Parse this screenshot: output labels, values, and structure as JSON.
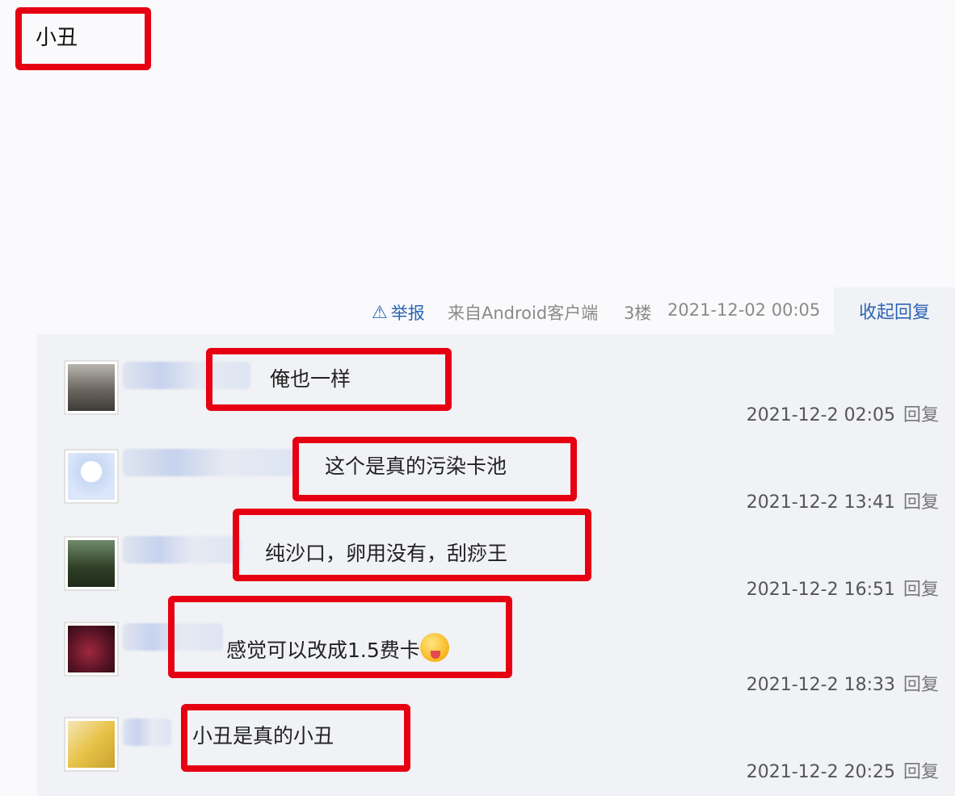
{
  "post": {
    "text": "小丑"
  },
  "post_meta": {
    "report_icon": "warning-triangle-icon",
    "report_label": "举报",
    "client": "来自Android客户端",
    "floor": "3楼",
    "time": "2021-12-02 00:05",
    "collapse_label": "收起回复"
  },
  "replies": [
    {
      "text": "俺也一样",
      "time": "2021-12-2 02:05",
      "reply_label": "回复"
    },
    {
      "text": "这个是真的污染卡池",
      "time": "2021-12-2 13:41",
      "reply_label": "回复"
    },
    {
      "text": "纯沙口，卵用没有，刮痧王",
      "time": "2021-12-2 16:51",
      "reply_label": "回复"
    },
    {
      "text": "感觉可以改成1.5费卡",
      "emoji": "tongue-out-emoji",
      "time": "2021-12-2 18:33",
      "reply_label": "回复"
    },
    {
      "text": "小丑是真的小丑",
      "time": "2021-12-2 20:25",
      "reply_label": "回复"
    }
  ],
  "colors": {
    "highlight_red": "#e60012",
    "link_blue": "#2d64b3",
    "panel_gray": "#f1f2f5"
  }
}
